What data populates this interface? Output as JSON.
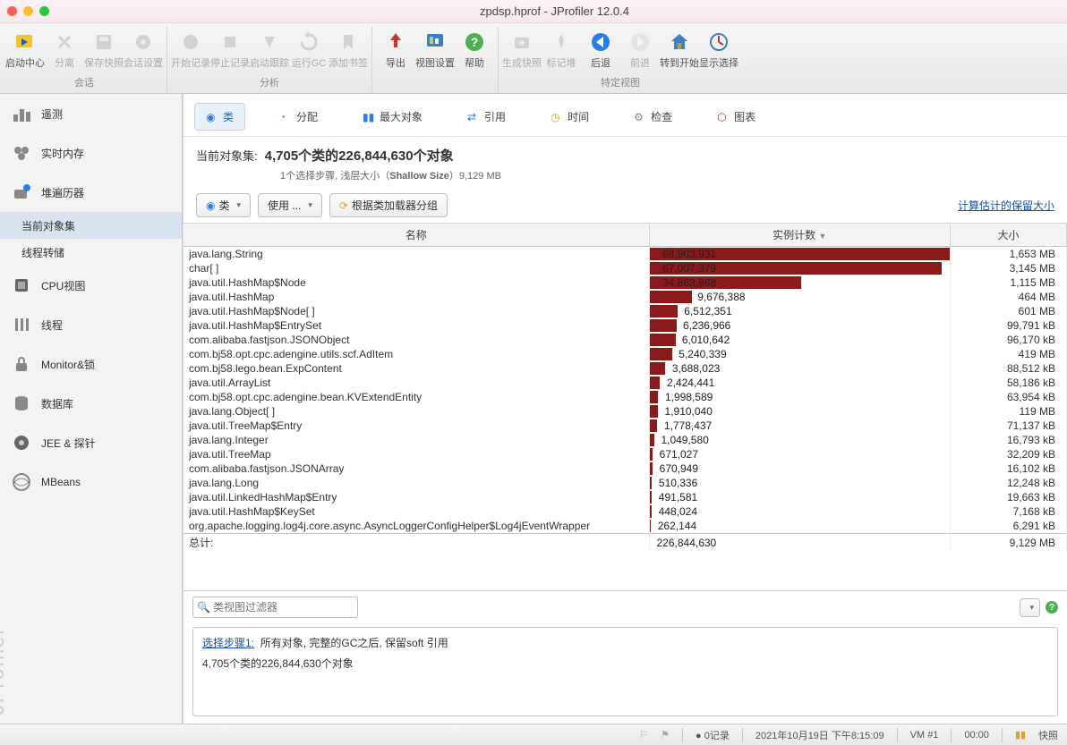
{
  "window": {
    "title": "zpdsp.hprof - JProfiler 12.0.4"
  },
  "toolbar": {
    "groups": [
      {
        "label": "会话",
        "items": [
          {
            "label": "启动中心",
            "icon": "start",
            "dim": false
          },
          {
            "label": "分离",
            "icon": "detach",
            "dim": true
          },
          {
            "label": "保存快照",
            "icon": "save",
            "dim": true
          },
          {
            "label": "会话设置",
            "icon": "settings",
            "dim": true
          }
        ]
      },
      {
        "label": "分析",
        "items": [
          {
            "label": "开始记录",
            "icon": "rec",
            "dim": true
          },
          {
            "label": "停止记录",
            "icon": "stoprec",
            "dim": true
          },
          {
            "label": "启动跟踪",
            "icon": "track",
            "dim": true
          },
          {
            "label": "运行GC",
            "icon": "gc",
            "dim": true
          },
          {
            "label": "添加书签",
            "icon": "bookmark",
            "dim": true
          }
        ]
      },
      {
        "label": "",
        "items": [
          {
            "label": "导出",
            "icon": "export",
            "dim": false
          },
          {
            "label": "视图设置",
            "icon": "viewset",
            "dim": false
          },
          {
            "label": "帮助",
            "icon": "help",
            "dim": false
          }
        ]
      },
      {
        "label": "特定视图",
        "items": [
          {
            "label": "生成快照",
            "icon": "snap",
            "dim": true
          },
          {
            "label": "标记堆",
            "icon": "pin",
            "dim": true
          },
          {
            "label": "后退",
            "icon": "back",
            "dim": false
          },
          {
            "label": "前进",
            "icon": "fwd",
            "dim": true
          },
          {
            "label": "转到开始",
            "icon": "home",
            "dim": false
          },
          {
            "label": "显示选择",
            "icon": "showsel",
            "dim": false
          }
        ]
      }
    ]
  },
  "sidebar": {
    "items": [
      {
        "label": "遥测",
        "icon": "telemetry"
      },
      {
        "label": "实时内存",
        "icon": "livemem"
      },
      {
        "label": "堆遍历器",
        "icon": "heapwalker"
      },
      {
        "label": "CPU视图",
        "icon": "cpu"
      },
      {
        "label": "线程",
        "icon": "threads"
      },
      {
        "label": "Monitor&锁",
        "icon": "lock"
      },
      {
        "label": "数据库",
        "icon": "db"
      },
      {
        "label": "JEE & 探针",
        "icon": "probes"
      },
      {
        "label": "MBeans",
        "icon": "mbeans"
      }
    ],
    "subs": [
      {
        "label": "当前对象集",
        "active": true
      },
      {
        "label": "线程转储",
        "active": false
      }
    ],
    "watermark": "JProfiler"
  },
  "tabs": {
    "items": [
      {
        "label": "类",
        "icon": "class",
        "active": true
      },
      {
        "label": "分配",
        "icon": "alloc"
      },
      {
        "label": "最大对象",
        "icon": "biggest"
      },
      {
        "label": "引用",
        "icon": "ref"
      },
      {
        "label": "时间",
        "icon": "time"
      },
      {
        "label": "检查",
        "icon": "inspect"
      },
      {
        "label": "图表",
        "icon": "graph"
      }
    ]
  },
  "summary": {
    "prefix": "当前对象集:",
    "main": "4,705个类的226,844,630个对象",
    "sub_prefix": "1个选择步骤, 浅层大小（",
    "sub_bold": "Shallow Size",
    "sub_suffix": "）9,129 MB"
  },
  "controls": {
    "btn_class": "类",
    "btn_use": "使用 ...",
    "btn_group": "根据类加载器分组",
    "link_retained": "计算估计的保留大小"
  },
  "table": {
    "headers": {
      "name": "名称",
      "count": "实例计数",
      "size": "大小"
    },
    "max_count": 68903931,
    "rows": [
      {
        "name": "java.lang.String",
        "count": "68,903,931",
        "countN": 68903931,
        "size": "1,653 MB"
      },
      {
        "name": "char[ ]",
        "count": "67,007,379",
        "countN": 67007379,
        "size": "3,145 MB"
      },
      {
        "name": "java.util.HashMap$Node",
        "count": "34,863,868",
        "countN": 34863868,
        "size": "1,115 MB"
      },
      {
        "name": "java.util.HashMap",
        "count": "9,676,388",
        "countN": 9676388,
        "size": "464 MB"
      },
      {
        "name": "java.util.HashMap$Node[ ]",
        "count": "6,512,351",
        "countN": 6512351,
        "size": "601 MB"
      },
      {
        "name": "java.util.HashMap$EntrySet",
        "count": "6,236,966",
        "countN": 6236966,
        "size": "99,791 kB"
      },
      {
        "name": "com.alibaba.fastjson.JSONObject",
        "count": "6,010,642",
        "countN": 6010642,
        "size": "96,170 kB"
      },
      {
        "name": "com.bj58.opt.cpc.adengine.utils.scf.AdItem",
        "count": "5,240,339",
        "countN": 5240339,
        "size": "419 MB"
      },
      {
        "name": "com.bj58.lego.bean.ExpContent",
        "count": "3,688,023",
        "countN": 3688023,
        "size": "88,512 kB"
      },
      {
        "name": "java.util.ArrayList",
        "count": "2,424,441",
        "countN": 2424441,
        "size": "58,186 kB"
      },
      {
        "name": "com.bj58.opt.cpc.adengine.bean.KVExtendEntity",
        "count": "1,998,589",
        "countN": 1998589,
        "size": "63,954 kB"
      },
      {
        "name": "java.lang.Object[ ]",
        "count": "1,910,040",
        "countN": 1910040,
        "size": "119 MB"
      },
      {
        "name": "java.util.TreeMap$Entry",
        "count": "1,778,437",
        "countN": 1778437,
        "size": "71,137 kB"
      },
      {
        "name": "java.lang.Integer",
        "count": "1,049,580",
        "countN": 1049580,
        "size": "16,793 kB"
      },
      {
        "name": "java.util.TreeMap",
        "count": "671,027",
        "countN": 671027,
        "size": "32,209 kB"
      },
      {
        "name": "com.alibaba.fastjson.JSONArray",
        "count": "670,949",
        "countN": 670949,
        "size": "16,102 kB"
      },
      {
        "name": "java.lang.Long",
        "count": "510,336",
        "countN": 510336,
        "size": "12,248 kB"
      },
      {
        "name": "java.util.LinkedHashMap$Entry",
        "count": "491,581",
        "countN": 491581,
        "size": "19,663 kB"
      },
      {
        "name": "java.util.HashMap$KeySet",
        "count": "448,024",
        "countN": 448024,
        "size": "7,168 kB"
      },
      {
        "name": "org.apache.logging.log4j.core.async.AsyncLoggerConfigHelper$Log4jEventWrapper",
        "count": "262,144",
        "countN": 262144,
        "size": "6,291 kB"
      }
    ],
    "total": {
      "label": "总计:",
      "count": "226,844,630",
      "size": "9,129 MB"
    }
  },
  "filter": {
    "placeholder": "类视图过滤器"
  },
  "stepbox": {
    "step_label": "选择步骤1:",
    "step_text": "所有对象, 完整的GC之后, 保留soft 引用",
    "line2": "4,705个类的226,844,630个对象"
  },
  "status": {
    "records": "0记录",
    "datetime": "2021年10月19日 下午8:15:09",
    "vm": "VM #1",
    "elapsed": "00:00",
    "snapshot": "快照"
  },
  "chart_data": {
    "type": "table",
    "title": "当前对象集",
    "columns": [
      "名称",
      "实例计数",
      "大小"
    ],
    "rows": [
      [
        "java.lang.String",
        68903931,
        "1,653 MB"
      ],
      [
        "char[]",
        67007379,
        "3,145 MB"
      ],
      [
        "java.util.HashMap$Node",
        34863868,
        "1,115 MB"
      ],
      [
        "java.util.HashMap",
        9676388,
        "464 MB"
      ],
      [
        "java.util.HashMap$Node[]",
        6512351,
        "601 MB"
      ],
      [
        "java.util.HashMap$EntrySet",
        6236966,
        "99,791 kB"
      ],
      [
        "com.alibaba.fastjson.JSONObject",
        6010642,
        "96,170 kB"
      ],
      [
        "com.bj58.opt.cpc.adengine.utils.scf.AdItem",
        5240339,
        "419 MB"
      ],
      [
        "com.bj58.lego.bean.ExpContent",
        3688023,
        "88,512 kB"
      ],
      [
        "java.util.ArrayList",
        2424441,
        "58,186 kB"
      ],
      [
        "com.bj58.opt.cpc.adengine.bean.KVExtendEntity",
        1998589,
        "63,954 kB"
      ],
      [
        "java.lang.Object[]",
        1910040,
        "119 MB"
      ],
      [
        "java.util.TreeMap$Entry",
        1778437,
        "71,137 kB"
      ],
      [
        "java.lang.Integer",
        1049580,
        "16,793 kB"
      ],
      [
        "java.util.TreeMap",
        671027,
        "32,209 kB"
      ],
      [
        "com.alibaba.fastjson.JSONArray",
        670949,
        "16,102 kB"
      ],
      [
        "java.lang.Long",
        510336,
        "12,248 kB"
      ],
      [
        "java.util.LinkedHashMap$Entry",
        491581,
        "19,663 kB"
      ],
      [
        "java.util.HashMap$KeySet",
        448024,
        "7,168 kB"
      ],
      [
        "org.apache.logging.log4j.core.async.AsyncLoggerConfigHelper$Log4jEventWrapper",
        262144,
        "6,291 kB"
      ]
    ],
    "total": [
      "总计",
      226844630,
      "9,129 MB"
    ]
  }
}
